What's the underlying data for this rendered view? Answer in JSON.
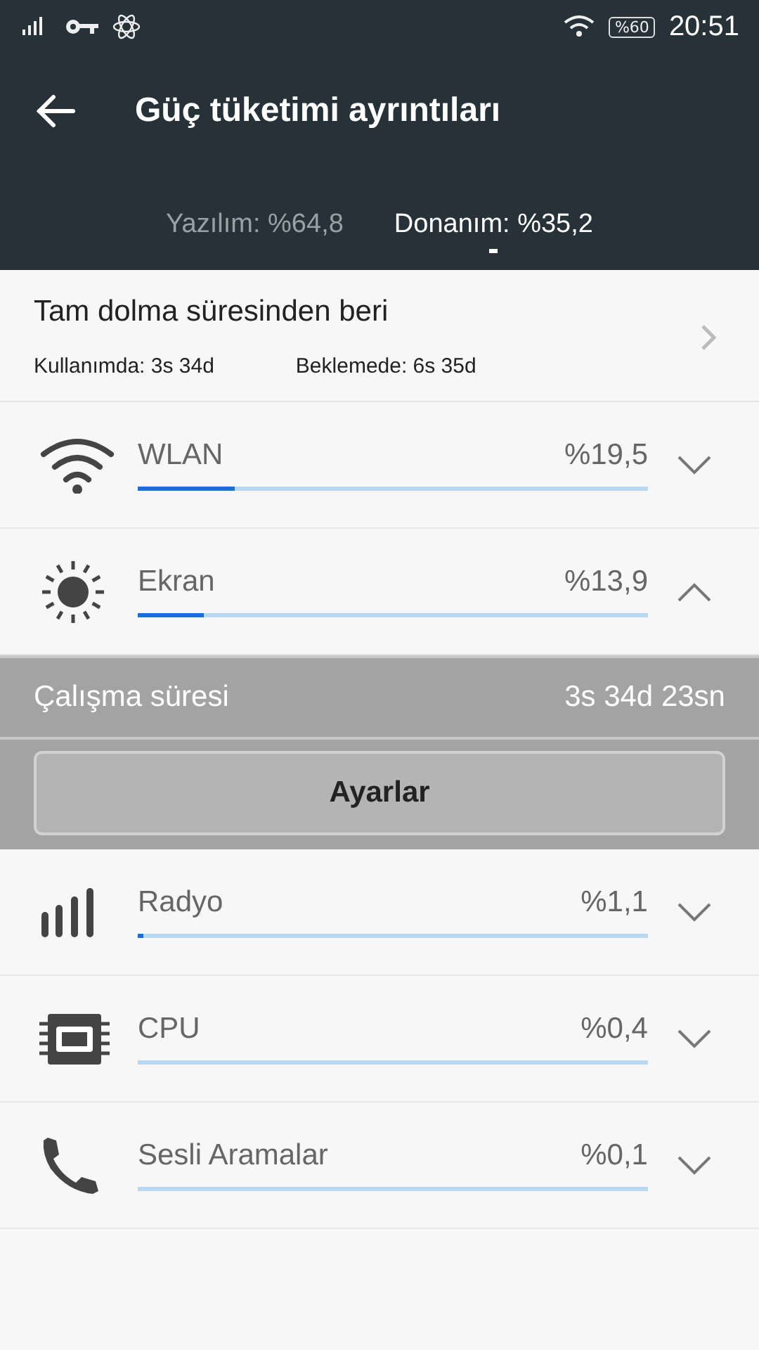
{
  "status_bar": {
    "battery": "%60",
    "time": "20:51"
  },
  "app_bar": {
    "title": "Güç tüketimi ayrıntıları"
  },
  "tabs": [
    {
      "label": "Yazılım: %64,8",
      "selected": false
    },
    {
      "label": "Donanım: %35,2",
      "selected": true
    }
  ],
  "summary": {
    "title": "Tam dolma süresinden beri",
    "in_use": "Kullanımda: 3s 34d",
    "standby": "Beklemede: 6s 35d"
  },
  "items": [
    {
      "kind": "wifi",
      "name": "WLAN",
      "percent": "%19,5",
      "level": 0.19,
      "expanded": false
    },
    {
      "kind": "screen",
      "name": "Ekran",
      "percent": "%13,9",
      "level": 0.13,
      "expanded": true,
      "details": {
        "label": "Çalışma süresi",
        "value": "3s 34d 23sn",
        "button": "Ayarlar"
      }
    },
    {
      "kind": "radio",
      "name": "Radyo",
      "percent": "%1,1",
      "level": 0.011,
      "expanded": false
    },
    {
      "kind": "cpu",
      "name": "CPU",
      "percent": "%0,4",
      "expanded": false
    },
    {
      "kind": "call",
      "name": "Sesli Aramalar",
      "percent": "%0,1",
      "expanded": false
    }
  ]
}
